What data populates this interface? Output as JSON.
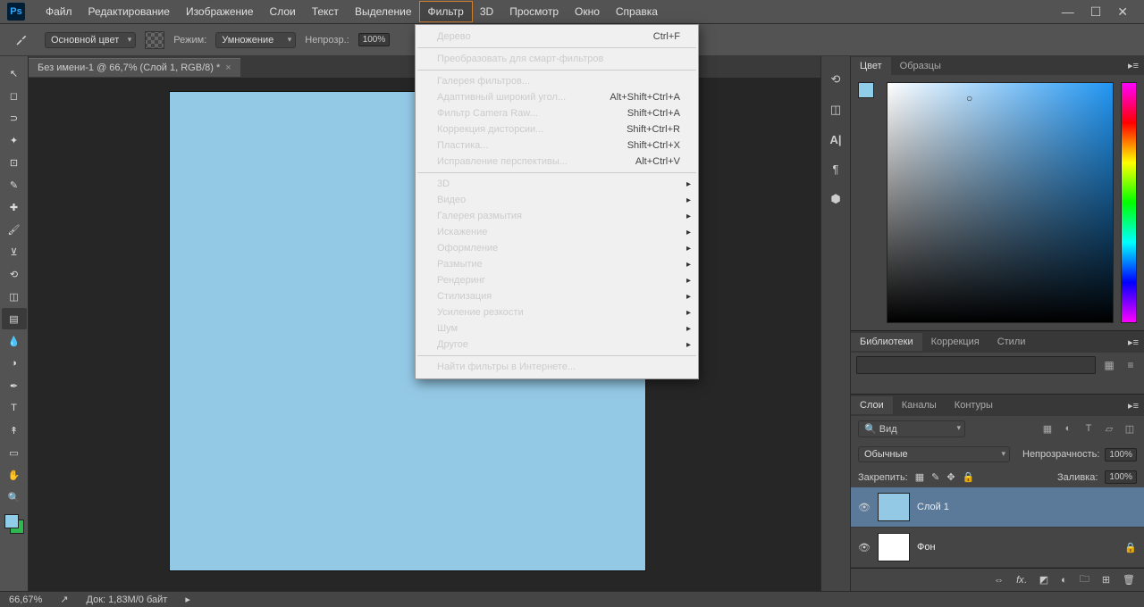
{
  "app": {
    "logo": "Ps"
  },
  "menubar": {
    "items": [
      "Файл",
      "Редактирование",
      "Изображение",
      "Слои",
      "Текст",
      "Выделение",
      "Фильтр",
      "3D",
      "Просмотр",
      "Окно",
      "Справка"
    ],
    "active_index": 6
  },
  "options_bar": {
    "foreground_label": "Основной цвет",
    "mode_label": "Режим:",
    "mode_value": "Умножение",
    "opacity_label": "Непрозр.:",
    "opacity_value": "100%"
  },
  "document": {
    "tab_title": "Без имени-1 @ 66,7% (Слой 1, RGB/8) *"
  },
  "status": {
    "zoom": "66,67%",
    "doc_info": "Док: 1,83M/0 байт"
  },
  "filter_menu": [
    {
      "label": "Дерево",
      "shortcut": "Ctrl+F"
    },
    {
      "sep": true
    },
    {
      "label": "Преобразовать для смарт-фильтров"
    },
    {
      "sep": true
    },
    {
      "label": "Галерея фильтров..."
    },
    {
      "label": "Адаптивный широкий угол...",
      "shortcut": "Alt+Shift+Ctrl+A"
    },
    {
      "label": "Фильтр Camera Raw...",
      "shortcut": "Shift+Ctrl+A"
    },
    {
      "label": "Коррекция дисторсии...",
      "shortcut": "Shift+Ctrl+R"
    },
    {
      "label": "Пластика...",
      "shortcut": "Shift+Ctrl+X"
    },
    {
      "label": "Исправление перспективы...",
      "shortcut": "Alt+Ctrl+V"
    },
    {
      "sep": true
    },
    {
      "label": "3D",
      "sub": true
    },
    {
      "label": "Видео",
      "sub": true
    },
    {
      "label": "Галерея размытия",
      "sub": true
    },
    {
      "label": "Искажение",
      "sub": true
    },
    {
      "label": "Оформление",
      "sub": true
    },
    {
      "label": "Размытие",
      "sub": true
    },
    {
      "label": "Рендеринг",
      "sub": true
    },
    {
      "label": "Стилизация",
      "sub": true
    },
    {
      "label": "Усиление резкости",
      "sub": true
    },
    {
      "label": "Шум",
      "sub": true
    },
    {
      "label": "Другое",
      "sub": true
    },
    {
      "sep": true
    },
    {
      "label": "Найти фильтры в Интернете..."
    }
  ],
  "panels": {
    "color_tabs": [
      "Цвет",
      "Образцы"
    ],
    "lib_tabs": [
      "Библиотеки",
      "Коррекция",
      "Стили"
    ],
    "layer_tabs": [
      "Слои",
      "Каналы",
      "Контуры"
    ],
    "layer_search_label": "Вид",
    "blend_mode": "Обычные",
    "opacity_label": "Непрозрачность:",
    "opacity_value": "100%",
    "lock_label": "Закрепить:",
    "fill_label": "Заливка:",
    "fill_value": "100%",
    "layers": [
      {
        "name": "Слой 1",
        "active": true,
        "bg": false
      },
      {
        "name": "Фон",
        "active": false,
        "bg": true
      }
    ]
  },
  "tools": [
    "move",
    "marquee",
    "lasso",
    "wand",
    "crop",
    "eyedropper",
    "heal",
    "brush",
    "stamp",
    "history",
    "eraser",
    "gradient",
    "blur",
    "dodge",
    "pen",
    "type",
    "path",
    "rect",
    "hand",
    "zoom"
  ]
}
